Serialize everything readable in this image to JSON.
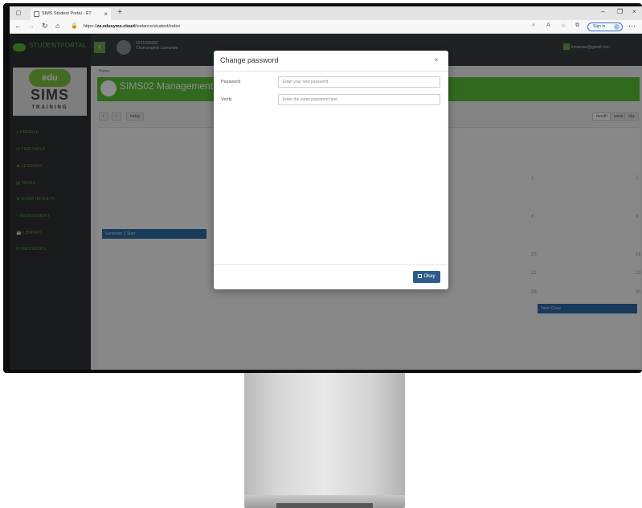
{
  "browser": {
    "tab_title": "SIMS Student Portal - ET",
    "url_host": "za.edusyms.cloud",
    "url_path": "/instance/student/index",
    "sign_in_label": "Sign in"
  },
  "app": {
    "brand": "STUDENTPORTAL",
    "logo_edu": "edu",
    "logo_sims": "SIMS",
    "logo_training": "TRAINING",
    "student_id": "0221000082",
    "student_name": "Chumangelis Lumanwe",
    "user_email": "lumanwe@gmail.com",
    "breadcrumb": "Home",
    "banner_title": "SIMS02 Management",
    "nav": [
      "PROFILE",
      "TIMETABLE",
      "LESSONS",
      "TASKS",
      "EXAM RESULTS",
      "ASSESSMENT",
      "LIBRARY",
      "MESSAGES"
    ],
    "calendar": {
      "today_label": "today",
      "views": [
        "month",
        "week",
        "day"
      ],
      "events": [
        "Semester 2 Start",
        "Term Close"
      ]
    }
  },
  "modal": {
    "title": "Change password",
    "close_glyph": "×",
    "password_label": "Password",
    "password_placeholder": "Enter your new password",
    "verify_label": "Verify",
    "verify_placeholder": "Enter the same password here",
    "ok_label": "Okay"
  },
  "colors": {
    "brand_green": "#59c23a",
    "primary_button": "#2e5c8a",
    "sidebar_bg": "#2c3133"
  }
}
